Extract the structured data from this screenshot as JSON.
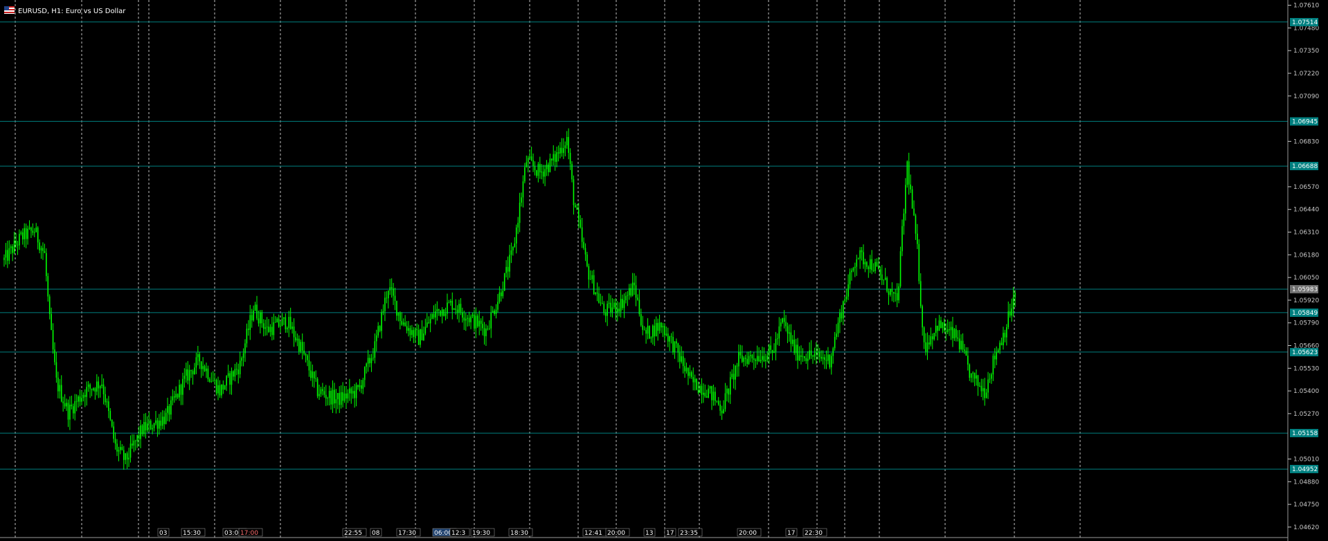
{
  "window": {
    "title": "EURUSD, H1:  Euro vs US Dollar",
    "flag_icon": "flag-icon"
  },
  "colors": {
    "background": "#000000",
    "candle": "#00ff00",
    "level_line": "#008080",
    "grid": "#c0c0c0",
    "axis_text": "#c8c8c8",
    "label_fill_teal": "#008080",
    "label_fill_gray": "#707070"
  },
  "price_axis": {
    "ticks": [
      "1.07610",
      "1.07480",
      "1.07350",
      "1.07220",
      "1.07090",
      "1.06830",
      "1.06570",
      "1.06440",
      "1.06310",
      "1.06180",
      "1.06050",
      "1.05920",
      "1.05790",
      "1.05660",
      "1.05530",
      "1.05400",
      "1.05270",
      "1.05010",
      "1.04880",
      "1.04750",
      "1.04620"
    ]
  },
  "levels": [
    {
      "label": "1.07514",
      "style": "teal"
    },
    {
      "label": "1.06945",
      "style": "teal"
    },
    {
      "label": "1.06688",
      "style": "teal"
    },
    {
      "label": "1.05983",
      "style": "gray"
    },
    {
      "label": "1.05849",
      "style": "teal"
    },
    {
      "label": "1.05623",
      "style": "teal"
    },
    {
      "label": "1.05158",
      "style": "teal"
    },
    {
      "label": "1.04952",
      "style": "teal"
    }
  ],
  "event_labels": [
    "03",
    "15:30",
    "03:00",
    "17:00",
    "22:55",
    "08",
    "17:30",
    "06:00",
    "12:3",
    "19:30",
    "18:30",
    "12:41",
    "20:00",
    "13",
    "17",
    "23:35",
    "20:00",
    "17",
    "22:30"
  ],
  "chart_data": {
    "type": "candlestick",
    "symbol": "EURUSD",
    "timeframe": "H1",
    "ylim": [
      1.0456,
      1.0764
    ],
    "grid": true,
    "path_low_to_high_points": [
      {
        "bar": 0,
        "price": 1.0615
      },
      {
        "bar": 10,
        "price": 1.0628
      },
      {
        "bar": 18,
        "price": 1.0632
      },
      {
        "bar": 24,
        "price": 1.0618
      },
      {
        "bar": 27,
        "price": 1.058
      },
      {
        "bar": 31,
        "price": 1.0545
      },
      {
        "bar": 38,
        "price": 1.0528
      },
      {
        "bar": 48,
        "price": 1.054
      },
      {
        "bar": 58,
        "price": 1.0545
      },
      {
        "bar": 66,
        "price": 1.0508
      },
      {
        "bar": 72,
        "price": 1.05
      },
      {
        "bar": 82,
        "price": 1.0518
      },
      {
        "bar": 96,
        "price": 1.0525
      },
      {
        "bar": 108,
        "price": 1.0548
      },
      {
        "bar": 116,
        "price": 1.0558
      },
      {
        "bar": 128,
        "price": 1.054
      },
      {
        "bar": 140,
        "price": 1.0555
      },
      {
        "bar": 148,
        "price": 1.0588
      },
      {
        "bar": 156,
        "price": 1.0575
      },
      {
        "bar": 168,
        "price": 1.058
      },
      {
        "bar": 176,
        "price": 1.0565
      },
      {
        "bar": 186,
        "price": 1.054
      },
      {
        "bar": 198,
        "price": 1.0535
      },
      {
        "bar": 210,
        "price": 1.054
      },
      {
        "bar": 220,
        "price": 1.0565
      },
      {
        "bar": 228,
        "price": 1.06
      },
      {
        "bar": 236,
        "price": 1.058
      },
      {
        "bar": 246,
        "price": 1.057
      },
      {
        "bar": 256,
        "price": 1.0585
      },
      {
        "bar": 266,
        "price": 1.059
      },
      {
        "bar": 276,
        "price": 1.0582
      },
      {
        "bar": 286,
        "price": 1.0575
      },
      {
        "bar": 294,
        "price": 1.0595
      },
      {
        "bar": 302,
        "price": 1.062
      },
      {
        "bar": 310,
        "price": 1.0672
      },
      {
        "bar": 318,
        "price": 1.0665
      },
      {
        "bar": 326,
        "price": 1.0672
      },
      {
        "bar": 334,
        "price": 1.0685
      },
      {
        "bar": 338,
        "price": 1.065
      },
      {
        "bar": 346,
        "price": 1.061
      },
      {
        "bar": 356,
        "price": 1.0585
      },
      {
        "bar": 366,
        "price": 1.059
      },
      {
        "bar": 374,
        "price": 1.06
      },
      {
        "bar": 380,
        "price": 1.0572
      },
      {
        "bar": 390,
        "price": 1.0578
      },
      {
        "bar": 398,
        "price": 1.0565
      },
      {
        "bar": 408,
        "price": 1.0545
      },
      {
        "bar": 418,
        "price": 1.054
      },
      {
        "bar": 426,
        "price": 1.053
      },
      {
        "bar": 436,
        "price": 1.0558
      },
      {
        "bar": 446,
        "price": 1.056
      },
      {
        "bar": 456,
        "price": 1.0562
      },
      {
        "bar": 462,
        "price": 1.058
      },
      {
        "bar": 470,
        "price": 1.0562
      },
      {
        "bar": 480,
        "price": 1.056
      },
      {
        "bar": 490,
        "price": 1.0558
      },
      {
        "bar": 498,
        "price": 1.059
      },
      {
        "bar": 506,
        "price": 1.0618
      },
      {
        "bar": 516,
        "price": 1.0612
      },
      {
        "bar": 524,
        "price": 1.06
      },
      {
        "bar": 530,
        "price": 1.059
      },
      {
        "bar": 536,
        "price": 1.067
      },
      {
        "bar": 542,
        "price": 1.062
      },
      {
        "bar": 546,
        "price": 1.0565
      },
      {
        "bar": 554,
        "price": 1.0578
      },
      {
        "bar": 566,
        "price": 1.057
      },
      {
        "bar": 574,
        "price": 1.0548
      },
      {
        "bar": 582,
        "price": 1.054
      },
      {
        "bar": 588,
        "price": 1.056
      },
      {
        "bar": 594,
        "price": 1.0575
      },
      {
        "bar": 600,
        "price": 1.0595
      }
    ]
  }
}
